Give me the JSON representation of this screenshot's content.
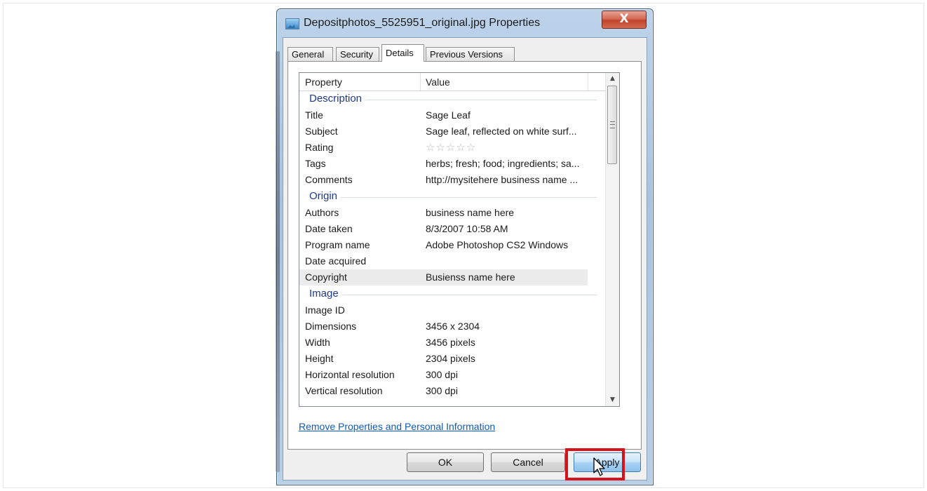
{
  "window": {
    "title": "Depositphotos_5525951_original.jpg Properties",
    "close_label": "X"
  },
  "tabs": [
    {
      "label": "General"
    },
    {
      "label": "Security"
    },
    {
      "label": "Details"
    },
    {
      "label": "Previous Versions"
    }
  ],
  "list": {
    "col_property": "Property",
    "col_value": "Value",
    "groups": [
      {
        "name": "Description"
      },
      {
        "name": "Origin"
      },
      {
        "name": "Image"
      }
    ],
    "rows": {
      "title": {
        "k": "Title",
        "v": "Sage Leaf"
      },
      "subject": {
        "k": "Subject",
        "v": "Sage leaf, reflected on white surf..."
      },
      "rating": {
        "k": "Rating",
        "v": "☆☆☆☆☆"
      },
      "tags": {
        "k": "Tags",
        "v": "herbs; fresh; food; ingredients; sa..."
      },
      "comments": {
        "k": "Comments",
        "v": "http://mysitehere business name ..."
      },
      "authors": {
        "k": "Authors",
        "v": "business name here"
      },
      "date_taken": {
        "k": "Date taken",
        "v": "8/3/2007 10:58 AM"
      },
      "program_name": {
        "k": "Program name",
        "v": "Adobe Photoshop CS2 Windows"
      },
      "date_acquired": {
        "k": "Date acquired",
        "v": ""
      },
      "copyright": {
        "k": "Copyright",
        "v": "Busienss name here"
      },
      "image_id": {
        "k": "Image ID",
        "v": ""
      },
      "dimensions": {
        "k": "Dimensions",
        "v": "3456 x 2304"
      },
      "width": {
        "k": "Width",
        "v": "3456 pixels"
      },
      "height": {
        "k": "Height",
        "v": "2304 pixels"
      },
      "h_res": {
        "k": "Horizontal resolution",
        "v": "300 dpi"
      },
      "v_res": {
        "k": "Vertical resolution",
        "v": "300 dpi"
      }
    }
  },
  "link": {
    "label": "Remove Properties and Personal Information"
  },
  "buttons": {
    "ok": "OK",
    "cancel": "Cancel",
    "apply": "Apply"
  },
  "colors": {
    "highlight": "#d6131b",
    "link": "#0b5bbb",
    "group_header": "#1e3a8a"
  }
}
